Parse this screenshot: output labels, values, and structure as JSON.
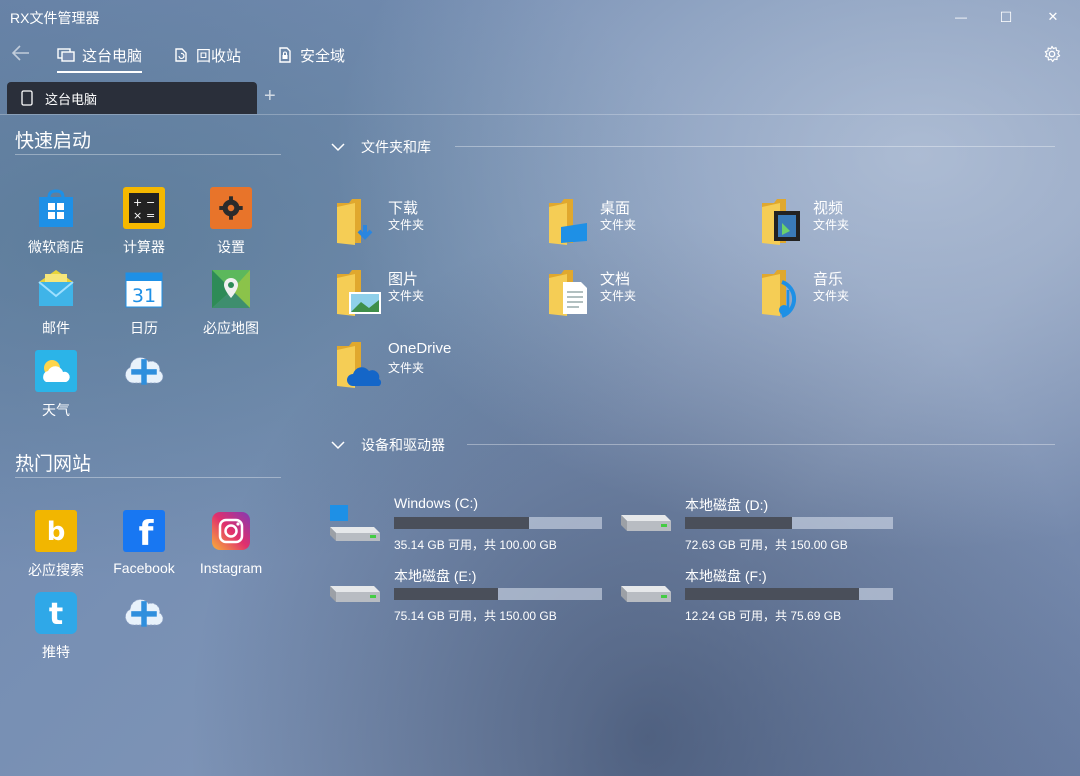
{
  "window": {
    "title": "RX文件管理器",
    "minimize": "—",
    "maximize": "☐",
    "close": "✕"
  },
  "nav": {
    "back_icon": "arrow-left-icon",
    "items": [
      {
        "label": "这台电脑",
        "icon": "pc-icon",
        "active": true
      },
      {
        "label": "回收站",
        "icon": "recycle-bin-icon",
        "active": false
      },
      {
        "label": "安全域",
        "icon": "lock-icon",
        "active": false
      }
    ],
    "settings_icon": "gear-icon"
  },
  "tabs": {
    "items": [
      {
        "label": "这台电脑",
        "icon": "tablet-icon"
      }
    ],
    "add": "+"
  },
  "quick_launch": {
    "title": "快速启动",
    "apps": [
      {
        "label": "微软商店",
        "icon": "store-icon"
      },
      {
        "label": "计算器",
        "icon": "calculator-icon"
      },
      {
        "label": "设置",
        "icon": "settings-icon"
      },
      {
        "label": "邮件",
        "icon": "mail-icon"
      },
      {
        "label": "日历",
        "icon": "calendar-icon",
        "glyph": "31"
      },
      {
        "label": "必应地图",
        "icon": "map-icon"
      },
      {
        "label": "天气",
        "icon": "weather-icon"
      },
      {
        "label": "",
        "icon": "add-icon"
      }
    ]
  },
  "hot_sites": {
    "title": "热门网站",
    "sites": [
      {
        "label": "必应搜索",
        "icon": "bing-icon",
        "glyph": "b"
      },
      {
        "label": "Facebook",
        "icon": "facebook-icon",
        "glyph": "f"
      },
      {
        "label": "Instagram",
        "icon": "instagram-icon"
      },
      {
        "label": "推特",
        "icon": "twitter-icon",
        "glyph": "t"
      },
      {
        "label": "",
        "icon": "add-icon"
      }
    ]
  },
  "libraries": {
    "title": "文件夹和库",
    "items": [
      {
        "name": "下载",
        "type": "文件夹",
        "icon": "download-folder-icon"
      },
      {
        "name": "桌面",
        "type": "文件夹",
        "icon": "desktop-folder-icon"
      },
      {
        "name": "视频",
        "type": "文件夹",
        "icon": "video-folder-icon"
      },
      {
        "name": "图片",
        "type": "文件夹",
        "icon": "pictures-folder-icon"
      },
      {
        "name": "文档",
        "type": "文件夹",
        "icon": "documents-folder-icon"
      },
      {
        "name": "音乐",
        "type": "文件夹",
        "icon": "music-folder-icon"
      },
      {
        "name": "OneDrive",
        "type": "文件夹",
        "icon": "onedrive-folder-icon"
      }
    ]
  },
  "devices": {
    "title": "设备和驱动器",
    "drives": [
      {
        "name": "Windows (C:)",
        "free_text": "35.14 GB 可用，共 100.00 GB",
        "used_fraction": 0.649,
        "icon": "system-drive-icon"
      },
      {
        "name": "本地磁盘 (D:)",
        "free_text": "72.63 GB 可用，共 150.00 GB",
        "used_fraction": 0.516,
        "icon": "drive-icon"
      },
      {
        "name": "本地磁盘 (E:)",
        "free_text": "75.14 GB 可用，共 150.00 GB",
        "used_fraction": 0.499,
        "icon": "drive-icon"
      },
      {
        "name": "本地磁盘 (F:)",
        "free_text": "12.24 GB 可用，共 75.69 GB",
        "used_fraction": 0.838,
        "icon": "drive-icon"
      }
    ]
  },
  "colors": {
    "accent": "#0078d7",
    "folder": "#f3c84b",
    "bar_fill": "#4a4f5a",
    "tab_bg": "#2a2f3a"
  }
}
